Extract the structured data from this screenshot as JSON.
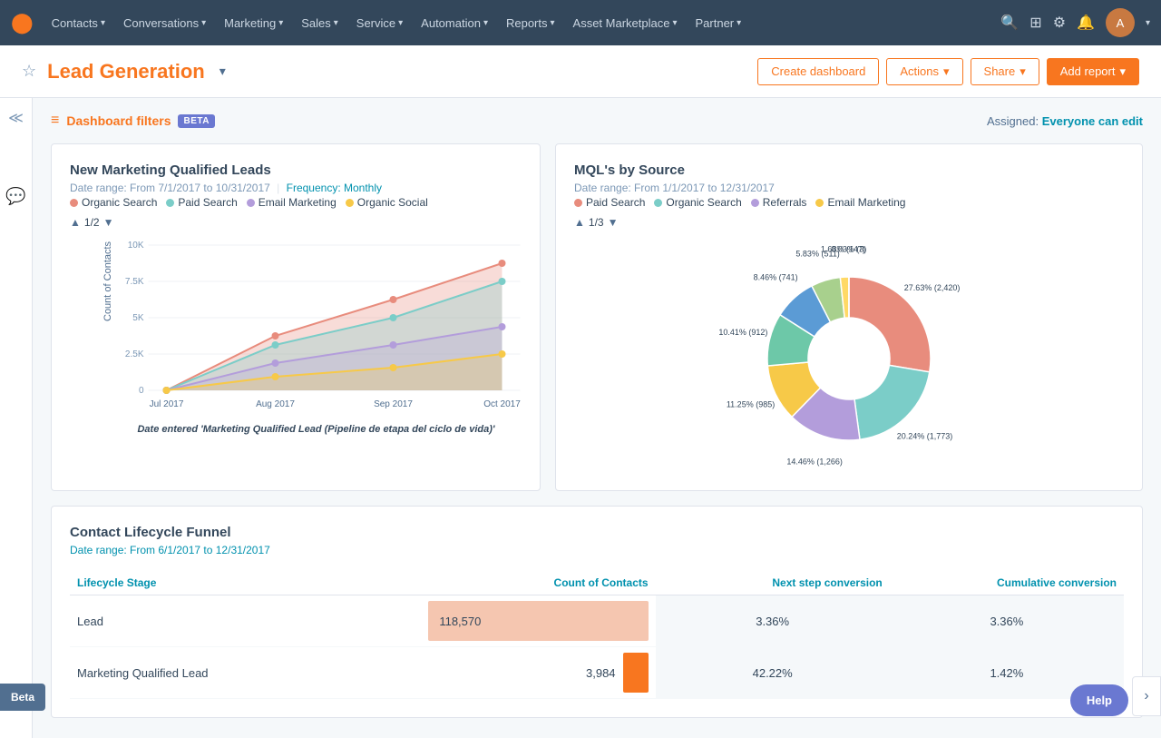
{
  "nav": {
    "logo": "🟠",
    "items": [
      {
        "label": "Contacts",
        "id": "contacts"
      },
      {
        "label": "Conversations",
        "id": "conversations"
      },
      {
        "label": "Marketing",
        "id": "marketing"
      },
      {
        "label": "Sales",
        "id": "sales"
      },
      {
        "label": "Service",
        "id": "service"
      },
      {
        "label": "Automation",
        "id": "automation"
      },
      {
        "label": "Reports",
        "id": "reports"
      },
      {
        "label": "Asset Marketplace",
        "id": "asset-marketplace"
      },
      {
        "label": "Partner",
        "id": "partner"
      }
    ]
  },
  "header": {
    "title": "Lead Generation",
    "star_label": "☆",
    "create_dashboard": "Create dashboard",
    "actions": "Actions",
    "share": "Share",
    "add_report": "Add report"
  },
  "filters": {
    "label": "Dashboard filters",
    "beta": "BETA",
    "assigned_label": "Assigned:",
    "assigned_value": "Everyone can edit"
  },
  "mql_card": {
    "title": "New Marketing Qualified Leads",
    "date_range": "Date range: From 7/1/2017 to 10/31/2017",
    "pipe": "|",
    "frequency": "Frequency: Monthly",
    "legend": [
      {
        "label": "Organic Search",
        "color": "#e88c7d"
      },
      {
        "label": "Paid Search",
        "color": "#7bcdc8"
      },
      {
        "label": "Email Marketing",
        "color": "#b39ddb"
      },
      {
        "label": "Organic Social",
        "color": "#f7c948"
      }
    ],
    "pagination": "1/2",
    "yaxis_label": "Count of Contacts",
    "xaxis_labels": [
      "Jul 2017",
      "Aug 2017",
      "Sep 2017",
      "Oct 2017"
    ],
    "yaxis_ticks": [
      "10K",
      "7.5K",
      "5K",
      "2.5K",
      "0"
    ],
    "xlabel": "Date entered 'Marketing Qualified Lead (Pipeline de etapa del ciclo de vida)'"
  },
  "mql_source_card": {
    "title": "MQL's by Source",
    "date_range": "Date range: From 1/1/2017 to 12/31/2017",
    "legend": [
      {
        "label": "Paid Search",
        "color": "#e88c7d"
      },
      {
        "label": "Organic Search",
        "color": "#7bcdc8"
      },
      {
        "label": "Referrals",
        "color": "#b39ddb"
      },
      {
        "label": "Email Marketing",
        "color": "#f7c948"
      }
    ],
    "pagination": "1/3",
    "segments": [
      {
        "label": "27.63% (2,420)",
        "color": "#e88c7d",
        "percent": 27.63
      },
      {
        "label": "20.24% (1,773)",
        "color": "#7bcdc8",
        "percent": 20.24
      },
      {
        "label": "14.46% (1,266)",
        "color": "#b39ddb",
        "percent": 14.46
      },
      {
        "label": "11.25% (985)",
        "color": "#f7c948",
        "percent": 11.25
      },
      {
        "label": "10.41% (912)",
        "color": "#6dc8a8",
        "percent": 10.41
      },
      {
        "label": "8.46% (741)",
        "color": "#5b9bd5",
        "percent": 8.46
      },
      {
        "label": "5.83% (511)",
        "color": "#a8d08d",
        "percent": 5.83
      },
      {
        "label": "1.68% (147)",
        "color": "#ffd966",
        "percent": 1.68
      },
      {
        "label": "0.03% (3)",
        "color": "#c5e0b4",
        "percent": 0.03
      }
    ]
  },
  "funnel_card": {
    "title": "Contact Lifecycle Funnel",
    "date_range": "Date range: From 6/1/2017 to 12/31/2017",
    "col_stage": "Lifecycle Stage",
    "col_contacts": "Count of Contacts",
    "col_next_step": "Next step conversion",
    "col_cumulative": "Cumulative conversion",
    "rows": [
      {
        "stage": "Lead",
        "count": "118,570",
        "bar_width_pct": 100,
        "next_step": "3.36%",
        "cumulative": "3.36%"
      },
      {
        "stage": "Marketing Qualified Lead",
        "count": "3,984",
        "bar_width_pct": 3.36,
        "next_step": "42.22%",
        "cumulative": "1.42%"
      }
    ]
  },
  "beta_button": "Beta",
  "help_button": "Help"
}
